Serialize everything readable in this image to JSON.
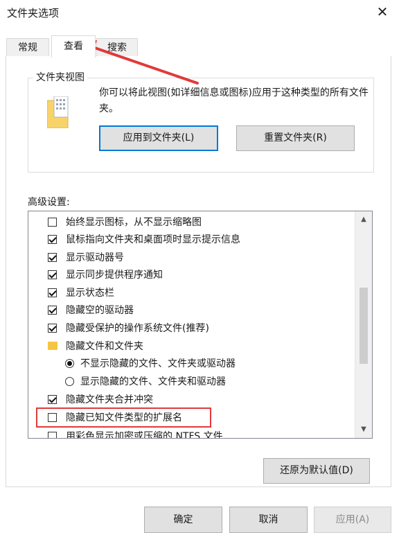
{
  "window": {
    "title": "文件夹选项",
    "close_icon": "close-icon"
  },
  "tabs": [
    {
      "label": "常规"
    },
    {
      "label": "查看",
      "active": true
    },
    {
      "label": "搜索"
    }
  ],
  "folder_views": {
    "legend": "文件夹视图",
    "description": "你可以将此视图(如详细信息或图标)应用于这种类型的所有文件夹。",
    "apply_button": "应用到文件夹(L)",
    "reset_button": "重置文件夹(R)"
  },
  "advanced": {
    "label": "高级设置:",
    "items": [
      {
        "type": "checkbox",
        "checked": false,
        "label": "始终显示图标，从不显示缩略图"
      },
      {
        "type": "checkbox",
        "checked": true,
        "label": "鼠标指向文件夹和桌面项时显示提示信息"
      },
      {
        "type": "checkbox",
        "checked": true,
        "label": "显示驱动器号"
      },
      {
        "type": "checkbox",
        "checked": true,
        "label": "显示同步提供程序通知"
      },
      {
        "type": "checkbox",
        "checked": true,
        "label": "显示状态栏"
      },
      {
        "type": "checkbox",
        "checked": true,
        "label": "隐藏空的驱动器"
      },
      {
        "type": "checkbox",
        "checked": true,
        "label": "隐藏受保护的操作系统文件(推荐)"
      },
      {
        "type": "folder",
        "label": "隐藏文件和文件夹"
      },
      {
        "type": "radio",
        "selected": true,
        "label": "不显示隐藏的文件、文件夹或驱动器"
      },
      {
        "type": "radio",
        "selected": false,
        "label": "显示隐藏的文件、文件夹和驱动器"
      },
      {
        "type": "checkbox",
        "checked": true,
        "label": "隐藏文件夹合并冲突"
      },
      {
        "type": "checkbox",
        "checked": false,
        "label": "隐藏已知文件类型的扩展名"
      },
      {
        "type": "checkbox",
        "checked": false,
        "label": "用彩色显示加密或压缩的 NTFS 文件"
      }
    ],
    "restore_button": "还原为默认值(D)"
  },
  "footer": {
    "ok": "确定",
    "cancel": "取消",
    "apply": "应用(A)"
  },
  "colors": {
    "highlight": "#e03a3a",
    "focus_border": "#0078d7"
  }
}
